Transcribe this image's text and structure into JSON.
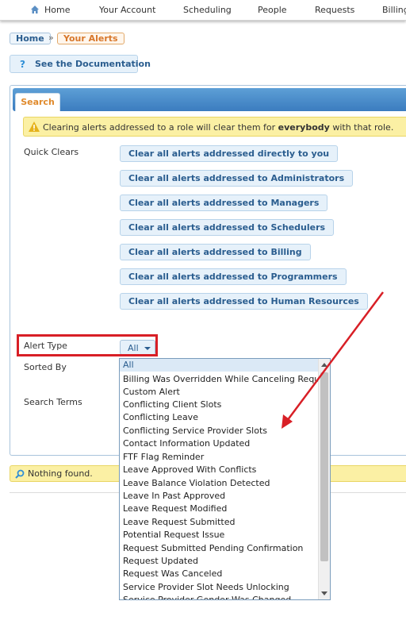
{
  "nav": {
    "items": [
      "Home",
      "Your Account",
      "Scheduling",
      "People",
      "Requests",
      "Billing"
    ]
  },
  "breadcrumb": {
    "home": "Home",
    "separator": "»",
    "current": "Your Alerts"
  },
  "doc_button": {
    "icon": "question-icon",
    "glyph": "?",
    "label": "See the Documentation"
  },
  "tabs": {
    "search": "Search"
  },
  "warning": {
    "before": "Clearing alerts addressed to a role will clear them for ",
    "bold": "everybody",
    "after": " with that role."
  },
  "quick_clears": {
    "label": "Quick Clears",
    "buttons": [
      "Clear all alerts addressed directly to you",
      "Clear all alerts addressed to Administrators",
      "Clear all alerts addressed to Managers",
      "Clear all alerts addressed to Schedulers",
      "Clear all alerts addressed to Billing",
      "Clear all alerts addressed to Programmers",
      "Clear all alerts addressed to Human Resources"
    ]
  },
  "fields": {
    "alert_type_label": "Alert Type",
    "alert_type_value": "All",
    "sorted_by_label": "Sorted By",
    "search_terms_label": "Search Terms"
  },
  "dropdown": {
    "options": [
      "All",
      "Billing Was Overridden While Canceling Request",
      "Custom Alert",
      "Conflicting Client Slots",
      "Conflicting Leave",
      "Conflicting Service Provider Slots",
      "Contact Information Updated",
      "FTF Flag Reminder",
      "Leave Approved With Conflicts",
      "Leave Balance Violation Detected",
      "Leave In Past Approved",
      "Leave Request Modified",
      "Leave Request Submitted",
      "Potential Request Issue",
      "Request Submitted Pending Confirmation",
      "Request Updated",
      "Request Was Canceled",
      "Service Provider Slot Needs Unlocking",
      "Service Provider Gender Was Changed"
    ],
    "selected": "All"
  },
  "nothing_found": "Nothing found.",
  "colors": {
    "accent_blue": "#2a5d8f",
    "tab_orange": "#e08a2c",
    "highlight_red": "#d81f26",
    "warning_yellow": "#fbf0a4"
  }
}
